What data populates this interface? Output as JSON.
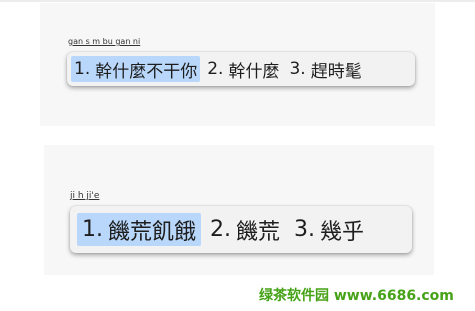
{
  "examples": [
    {
      "preedit": "gan s m bu gan ni",
      "candidates": [
        {
          "number": "1.",
          "text": "幹什麼不干你",
          "selected": true
        },
        {
          "number": "2.",
          "text": "幹什麼",
          "selected": false
        },
        {
          "number": "3.",
          "text": "趕時髦",
          "selected": false
        }
      ]
    },
    {
      "preedit": "ji h ji'e",
      "candidates": [
        {
          "number": "1.",
          "text": "饑荒飢餓",
          "selected": true
        },
        {
          "number": "2.",
          "text": "饑荒",
          "selected": false
        },
        {
          "number": "3.",
          "text": "幾乎",
          "selected": false
        }
      ]
    }
  ],
  "watermark": "绿茶软件园 www.6686.com",
  "colors": {
    "selection": "#b8d7fa",
    "watermark": "#46a317"
  }
}
